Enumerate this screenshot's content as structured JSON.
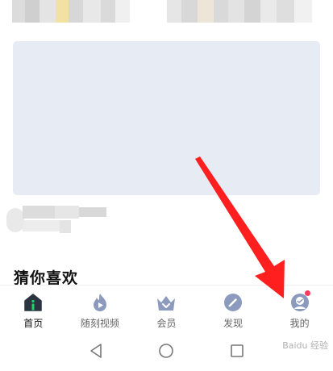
{
  "feed": {
    "section_title": "猜你喜欢"
  },
  "tabs": [
    {
      "label": "首页",
      "icon": "home-icon",
      "active": true
    },
    {
      "label": "随刻视频",
      "icon": "flame-play-icon",
      "active": false
    },
    {
      "label": "会员",
      "icon": "crown-icon",
      "active": false,
      "badge": true
    },
    {
      "label": "发现",
      "icon": "compass-icon",
      "active": false
    },
    {
      "label": "我的",
      "icon": "user-icon",
      "active": false
    }
  ],
  "system_nav": [
    "back-icon",
    "home-circle-icon",
    "recents-icon"
  ],
  "colors": {
    "icon_inactive": "#8c9bbd",
    "icon_active_body": "#2b3440",
    "accent_green": "#21d36a",
    "badge": "#ff3a5a",
    "arrow": "#ff1f1f",
    "banner": "#e7ebf3"
  },
  "watermark": "Baidu 经验"
}
